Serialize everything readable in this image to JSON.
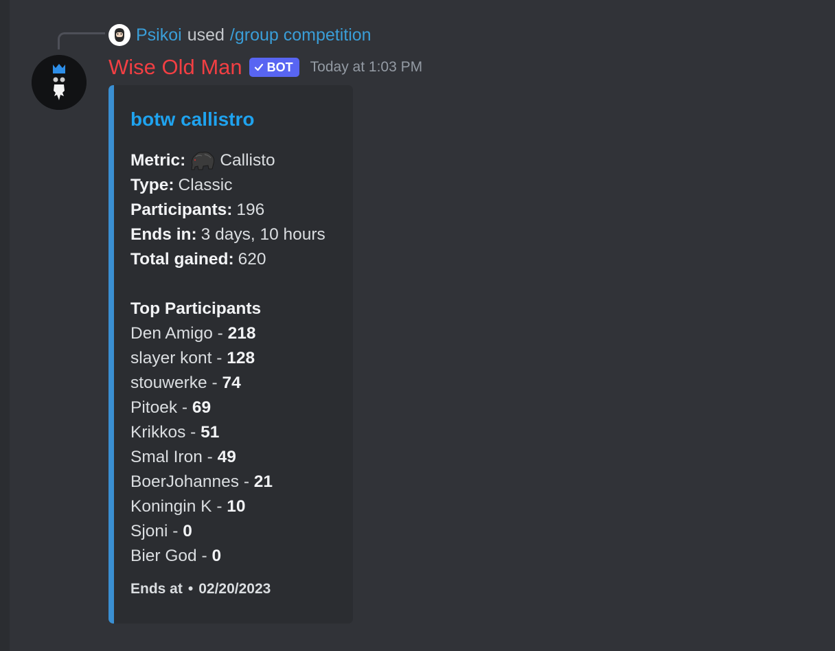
{
  "reply": {
    "user": "Psikoi",
    "used_text": "used",
    "command": "/group competition"
  },
  "message": {
    "username": "Wise Old Man",
    "bot_tag": "BOT",
    "timestamp": "Today at 1:03 PM"
  },
  "embed": {
    "title": "botw callistro",
    "fields": {
      "metric_label": "Metric:",
      "metric_value": "Callisto",
      "type_label": "Type:",
      "type_value": "Classic",
      "participants_label": "Participants:",
      "participants_value": "196",
      "ends_in_label": "Ends in:",
      "ends_in_value": "3 days, 10 hours",
      "total_gained_label": "Total gained:",
      "total_gained_value": "620"
    },
    "top_heading": "Top Participants",
    "top_participants": [
      {
        "name": "Den Amigo",
        "sep": " - ",
        "score": "218"
      },
      {
        "name": "slayer kont",
        "sep": " - ",
        "score": "128"
      },
      {
        "name": "stouwerke",
        "sep": " - ",
        "score": "74"
      },
      {
        "name": "Pitoek",
        "sep": " - ",
        "score": "69"
      },
      {
        "name": "Krikkos",
        "sep": " - ",
        "score": "51"
      },
      {
        "name": "Smal Iron",
        "sep": " - ",
        "score": "49"
      },
      {
        "name": "BoerJohannes",
        "sep": " - ",
        "score": "21"
      },
      {
        "name": "Koningin K",
        "sep": " - ",
        "score": "10"
      },
      {
        "name": "Sjoni",
        "sep": " - ",
        "score": "0"
      },
      {
        "name": "Bier God",
        "sep": " - ",
        "score": "0"
      }
    ],
    "footer_label": "Ends at",
    "footer_dot": "•",
    "footer_date": "02/20/2023"
  },
  "colors": {
    "background": "#313338",
    "embed_background": "#2b2d31",
    "embed_accent": "#3a8fd2",
    "username": "#f23f43",
    "bot_tag": "#5865f2",
    "link": "#3a9ed8",
    "title": "#1fa3ef"
  },
  "icons": {
    "reply_avatar": "bearded-face-avatar-icon",
    "bot_avatar": "wise-old-man-avatar-icon",
    "bot_verified": "checkmark-icon",
    "metric": "callisto-bear-icon"
  }
}
